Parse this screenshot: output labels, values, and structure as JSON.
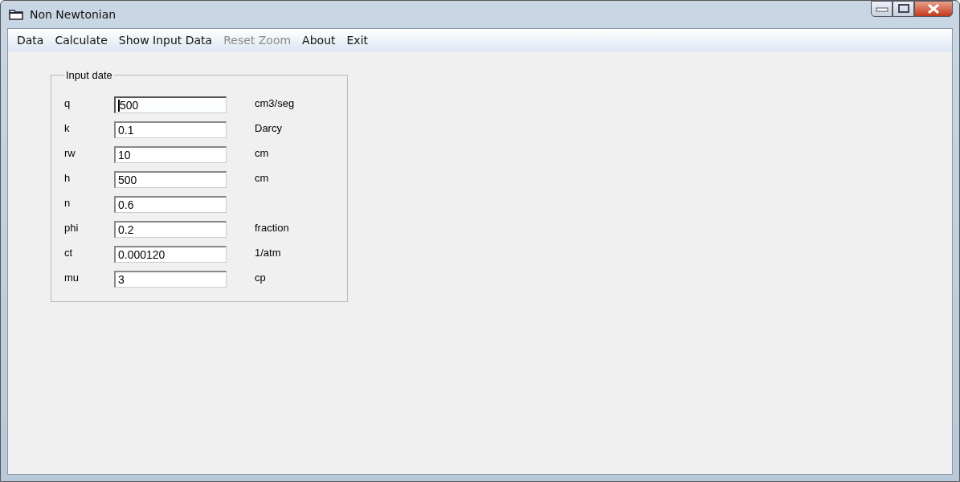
{
  "window": {
    "title": "Non Newtonian"
  },
  "menu": [
    {
      "label": "Data",
      "disabled": false
    },
    {
      "label": "Calculate",
      "disabled": false
    },
    {
      "label": "Show Input Data",
      "disabled": false
    },
    {
      "label": "Reset Zoom",
      "disabled": true
    },
    {
      "label": "About",
      "disabled": false
    },
    {
      "label": "Exit",
      "disabled": false
    }
  ],
  "group": {
    "title": "Input date",
    "fields": [
      {
        "label": "q",
        "value": "500",
        "unit": "cm3/seg",
        "focused": true
      },
      {
        "label": "k",
        "value": "0.1",
        "unit": "Darcy",
        "focused": false
      },
      {
        "label": "rw",
        "value": "10",
        "unit": "cm",
        "focused": false
      },
      {
        "label": "h",
        "value": "500",
        "unit": "cm",
        "focused": false
      },
      {
        "label": "n",
        "value": "0.6",
        "focused": false
      },
      {
        "label": "phi",
        "value": "0.2",
        "unit": "fraction",
        "focused": false
      },
      {
        "label": "ct",
        "value": "0.000120",
        "unit": "1/atm",
        "focused": false
      },
      {
        "label": "mu",
        "value": "3",
        "unit": "cp",
        "focused": false
      }
    ]
  }
}
